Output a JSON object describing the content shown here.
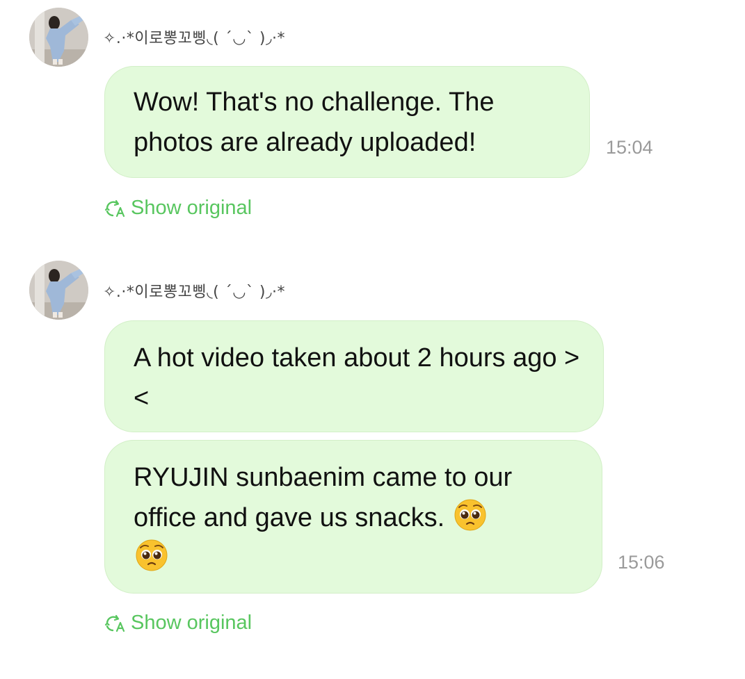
{
  "messages": [
    {
      "sender": "✧.·*이로뽕꼬삥◟( ˊ◡ˋ )◞·*",
      "bubbles": [
        {
          "text": "Wow! That's no challenge. The photos are already uploaded!",
          "emoji": ""
        }
      ],
      "time": "15:04",
      "show_original": "Show original"
    },
    {
      "sender": "✧.·*이로뽕꼬삥◟( ˊ◡ˋ )◞·*",
      "bubbles": [
        {
          "text": "A hot video taken about 2 hours ago ><",
          "emoji": ""
        },
        {
          "text": "RYUJIN sunbaenim came to our office and gave us snacks.",
          "emoji": "pleading-face"
        }
      ],
      "time": "15:06",
      "show_original": "Show original"
    }
  ],
  "colors": {
    "bubble_bg": "#e3fadb",
    "accent_green": "#58c65f",
    "timestamp": "#9a9a9a"
  }
}
